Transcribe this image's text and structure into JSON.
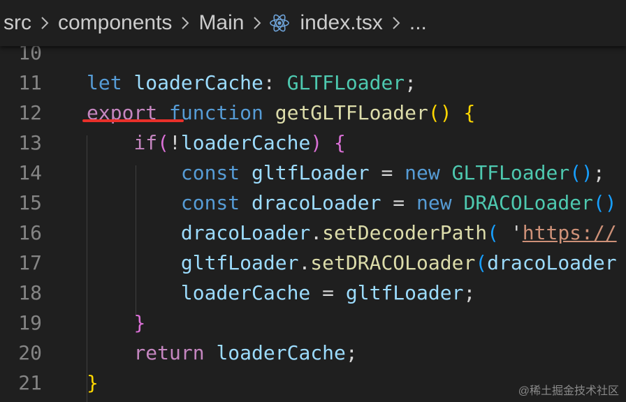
{
  "breadcrumb": {
    "items": [
      "src",
      "components",
      "Main",
      "index.tsx",
      "..."
    ],
    "file_icon": "react-icon"
  },
  "editor": {
    "language": "tsx",
    "lines": [
      {
        "number": "10",
        "tokens": []
      },
      {
        "number": "11",
        "tokens": [
          {
            "t": "let",
            "c": "k-storage"
          },
          {
            "t": " ",
            "c": "punc"
          },
          {
            "t": "loaderCache",
            "c": "var"
          },
          {
            "t": ": ",
            "c": "punc"
          },
          {
            "t": "GLTFLoader",
            "c": "type"
          },
          {
            "t": ";",
            "c": "punc"
          }
        ]
      },
      {
        "number": "12",
        "tokens": [
          {
            "t": "export",
            "c": "k-ctrl"
          },
          {
            "t": " ",
            "c": "punc"
          },
          {
            "t": "function",
            "c": "k-storage"
          },
          {
            "t": " ",
            "c": "punc"
          },
          {
            "t": "getGLTFLoader",
            "c": "fn"
          },
          {
            "t": "()",
            "c": "br1"
          },
          {
            "t": " ",
            "c": "punc"
          },
          {
            "t": "{",
            "c": "br1"
          }
        ]
      },
      {
        "number": "13",
        "tokens": [
          {
            "t": "    ",
            "c": "punc"
          },
          {
            "t": "if",
            "c": "k-ctrl"
          },
          {
            "t": "(",
            "c": "br2"
          },
          {
            "t": "!",
            "c": "punc"
          },
          {
            "t": "loaderCache",
            "c": "var"
          },
          {
            "t": ")",
            "c": "br2"
          },
          {
            "t": " ",
            "c": "punc"
          },
          {
            "t": "{",
            "c": "br2"
          }
        ]
      },
      {
        "number": "14",
        "tokens": [
          {
            "t": "        ",
            "c": "punc"
          },
          {
            "t": "const",
            "c": "k-storage"
          },
          {
            "t": " ",
            "c": "punc"
          },
          {
            "t": "gltfLoader",
            "c": "var"
          },
          {
            "t": " = ",
            "c": "punc"
          },
          {
            "t": "new",
            "c": "k-storage"
          },
          {
            "t": " ",
            "c": "punc"
          },
          {
            "t": "GLTFLoader",
            "c": "type"
          },
          {
            "t": "()",
            "c": "br3"
          },
          {
            "t": ";",
            "c": "punc"
          }
        ]
      },
      {
        "number": "15",
        "tokens": [
          {
            "t": "        ",
            "c": "punc"
          },
          {
            "t": "const",
            "c": "k-storage"
          },
          {
            "t": " ",
            "c": "punc"
          },
          {
            "t": "dracoLoader",
            "c": "var"
          },
          {
            "t": " = ",
            "c": "punc"
          },
          {
            "t": "new",
            "c": "k-storage"
          },
          {
            "t": " ",
            "c": "punc"
          },
          {
            "t": "DRACOLoader",
            "c": "type"
          },
          {
            "t": "()",
            "c": "br3"
          }
        ]
      },
      {
        "number": "16",
        "tokens": [
          {
            "t": "        ",
            "c": "punc"
          },
          {
            "t": "dracoLoader",
            "c": "var"
          },
          {
            "t": ".",
            "c": "punc"
          },
          {
            "t": "setDecoderPath",
            "c": "fn"
          },
          {
            "t": "(",
            "c": "br3"
          },
          {
            "t": " ",
            "c": "punc"
          },
          {
            "t": "'",
            "c": "punc"
          },
          {
            "t": "https://",
            "c": "str"
          }
        ]
      },
      {
        "number": "17",
        "tokens": [
          {
            "t": "        ",
            "c": "punc"
          },
          {
            "t": "gltfLoader",
            "c": "var"
          },
          {
            "t": ".",
            "c": "punc"
          },
          {
            "t": "setDRACOLoader",
            "c": "fn"
          },
          {
            "t": "(",
            "c": "br3"
          },
          {
            "t": "dracoLoader",
            "c": "var"
          }
        ]
      },
      {
        "number": "18",
        "tokens": [
          {
            "t": "        ",
            "c": "punc"
          },
          {
            "t": "loaderCache",
            "c": "var"
          },
          {
            "t": " = ",
            "c": "punc"
          },
          {
            "t": "gltfLoader",
            "c": "var"
          },
          {
            "t": ";",
            "c": "punc"
          }
        ]
      },
      {
        "number": "19",
        "tokens": [
          {
            "t": "    ",
            "c": "punc"
          },
          {
            "t": "}",
            "c": "br2"
          }
        ]
      },
      {
        "number": "20",
        "tokens": [
          {
            "t": "    ",
            "c": "punc"
          },
          {
            "t": "return",
            "c": "k-ctrl"
          },
          {
            "t": " ",
            "c": "punc"
          },
          {
            "t": "loaderCache",
            "c": "var"
          },
          {
            "t": ";",
            "c": "punc"
          }
        ]
      },
      {
        "number": "21",
        "tokens": [
          {
            "t": "}",
            "c": "br1"
          }
        ]
      }
    ]
  },
  "watermark": "@稀土掘金技术社区",
  "colors": {
    "background": "#1f1f1f",
    "annotation_underline": "#e8302a"
  }
}
